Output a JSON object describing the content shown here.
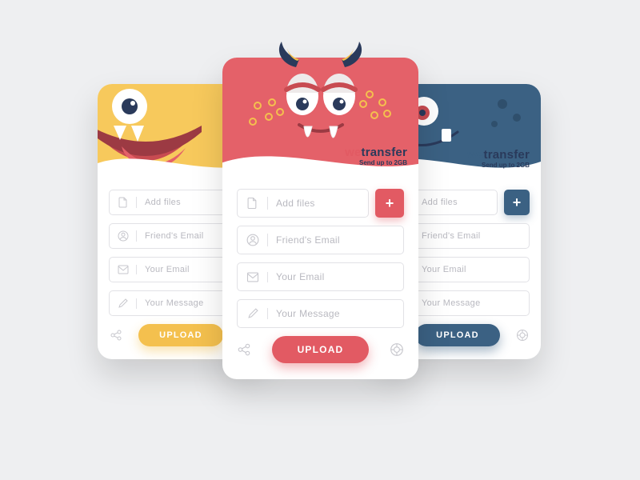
{
  "brand": {
    "logo_prefix": "we",
    "logo_suffix": "transfer",
    "subtitle": "Send up to 2GB"
  },
  "fields": {
    "add_files": "Add files",
    "friend_email": "Friend's Email",
    "your_email": "Your Email",
    "your_message": "Your Message"
  },
  "buttons": {
    "upload": "UPLOAD",
    "add": "+"
  },
  "colors": {
    "yellow": "#f4c04e",
    "red": "#e25a63",
    "blue": "#3b6183",
    "navy": "#2a3a5b"
  }
}
